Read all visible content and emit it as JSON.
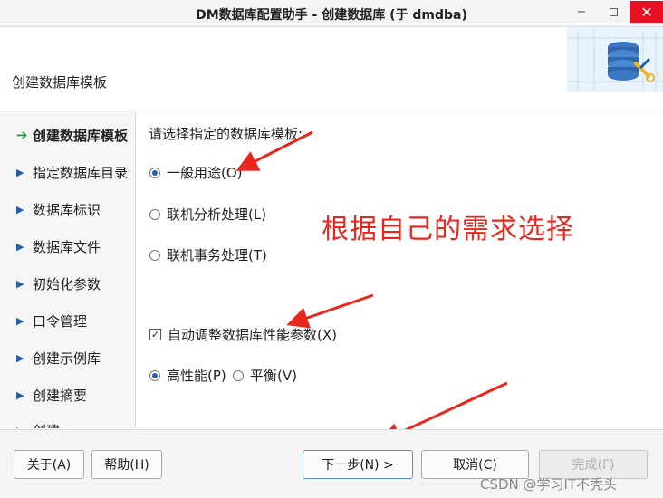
{
  "window": {
    "title": "DM数据库配置助手 - 创建数据库 (于 dmdba)",
    "minimize_glyph": "−",
    "close_glyph": "✕"
  },
  "header": {
    "title": "创建数据库模板",
    "art_icon": "database-wrench-icon"
  },
  "sidebar": {
    "steps": [
      {
        "label": "创建数据库模板",
        "current": true,
        "marker": "➔"
      },
      {
        "label": "指定数据库目录",
        "marker": "▶"
      },
      {
        "label": "数据库标识",
        "marker": "▶"
      },
      {
        "label": "数据库文件",
        "marker": "▶"
      },
      {
        "label": "初始化参数",
        "marker": "▶"
      },
      {
        "label": "口令管理",
        "marker": "▶"
      },
      {
        "label": "创建示例库",
        "marker": "▶"
      },
      {
        "label": "创建摘要",
        "marker": "▶"
      },
      {
        "label": "创建",
        "marker": "▶"
      }
    ]
  },
  "main": {
    "prompt": "请选择指定的数据库模板:",
    "templates": [
      {
        "label": "一般用途(O)",
        "selected": true
      },
      {
        "label": "联机分析处理(L)",
        "selected": false
      },
      {
        "label": "联机事务处理(T)",
        "selected": false
      }
    ],
    "auto_tune": {
      "label": "自动调整数据库性能参数(X)",
      "checked": true,
      "check_glyph": "✓"
    },
    "performance": [
      {
        "label": "高性能(P)",
        "selected": true
      },
      {
        "label": "平衡(V)",
        "selected": false
      }
    ]
  },
  "annotation": {
    "text": "根据自己的需求选择",
    "color": "#e8261c"
  },
  "footer": {
    "about": "关于(A)",
    "help": "帮助(H)",
    "next": "下一步(N) >",
    "cancel": "取消(C)",
    "finish": "完成(F)"
  },
  "watermark": "CSDN @学习IT不秃头",
  "colors": {
    "accent": "#1f5fa8",
    "current_step_arrow": "#1f9d3a",
    "close_button": "#e81123",
    "annotation_red": "#e8261c"
  }
}
